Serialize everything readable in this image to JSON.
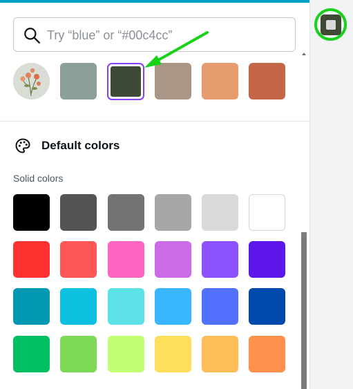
{
  "search": {
    "placeholder": "Try “blue” or “#00c4cc”"
  },
  "document_colors": {
    "photo_swatch": {
      "icon": "flower-photo"
    },
    "swatches": [
      {
        "color": "#8c9e99"
      },
      {
        "color": "#3e4a36",
        "selected": true
      },
      {
        "color": "#a99686"
      },
      {
        "color": "#e69c6d"
      },
      {
        "color": "#c56548"
      }
    ]
  },
  "default_colors": {
    "icon": "palette-icon",
    "title": "Default colors",
    "solid_label": "Solid colors",
    "rows": [
      [
        "#000000",
        "#545454",
        "#737373",
        "#a6a6a6",
        "#d9d9d9",
        "#ffffff"
      ],
      [
        "#ff3131",
        "#ff5757",
        "#ff66c4",
        "#cb6ce6",
        "#8c52ff",
        "#5e17eb"
      ],
      [
        "#0097b2",
        "#0cc0df",
        "#5ce1e6",
        "#38b6ff",
        "#5271ff",
        "#004aad"
      ],
      [
        "#00bf63",
        "#7ed957",
        "#c1ff72",
        "#ffde59",
        "#ffbd59",
        "#ff914d"
      ]
    ]
  },
  "rail": {
    "color_button_color": "#3e4a36",
    "highlight_color": "#19d119"
  },
  "annotation": {
    "arrow_color": "#19d119"
  }
}
